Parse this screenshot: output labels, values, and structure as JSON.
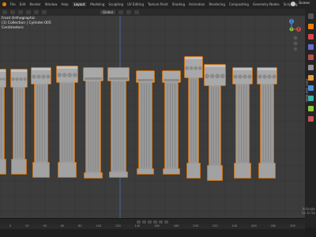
{
  "app": {
    "scene": "Scene"
  },
  "menu": [
    "File",
    "Edit",
    "Render",
    "Window",
    "Help"
  ],
  "workspace_tabs": [
    "Layout",
    "Modeling",
    "Sculpting",
    "UV Editing",
    "Texture Paint",
    "Shading",
    "Animation",
    "Rendering",
    "Compositing",
    "Geometry Nodes",
    "Scripting"
  ],
  "active_tab": 0,
  "viewport_header": {
    "orientation": "Global"
  },
  "viewport": {
    "view_name": "Front Orthographic",
    "collection": "(1) Collection | Cylinder.005",
    "units": "Centimeters"
  },
  "gizmo": {
    "labels": [
      "X",
      "Y",
      "Z"
    ]
  },
  "side_tabs": [
    "Item",
    "Tool",
    "View"
  ],
  "timeline": {
    "ticks": [
      "0",
      "20",
      "40",
      "60",
      "80",
      "100",
      "120",
      "140",
      "160",
      "180",
      "200",
      "220",
      "240",
      "260",
      "280",
      "300"
    ]
  },
  "overlay": {
    "activate_line1": "Activate",
    "activate_line2": "Go to Se"
  },
  "colors": {
    "background": "#3c3c3c",
    "selection": "#e87d0d",
    "column": "#9a9a9a",
    "x_axis": "#d44747",
    "y_axis": "#8cc63f",
    "z_axis": "#4b8fe3"
  }
}
